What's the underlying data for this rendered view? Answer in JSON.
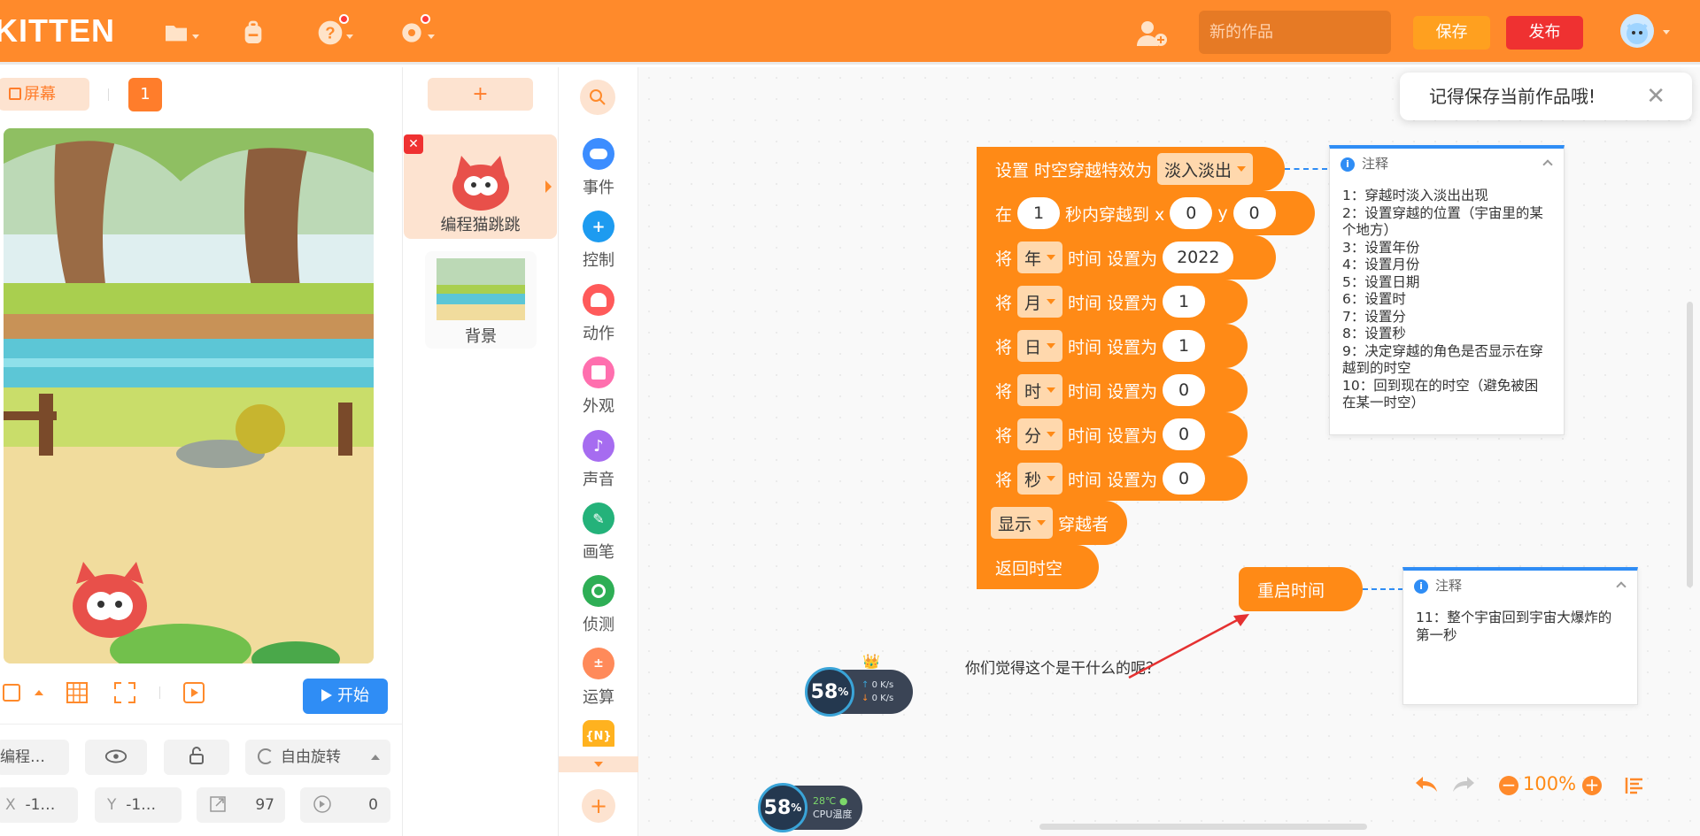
{
  "app": {
    "logo": "KITTEN",
    "project_title_placeholder": "新的作品",
    "save_label": "保存",
    "publish_label": "发布"
  },
  "stage": {
    "screen_button": "屏幕",
    "scene_number": "1",
    "start_label": "开始",
    "sprite_name_field": "编程…",
    "rotate_mode": "自由旋转",
    "x_label": "X",
    "x_value": "-1…",
    "y_label": "Y",
    "y_value": "-1…",
    "size_value": "97",
    "direction_value": "0"
  },
  "sprites": {
    "add_label": "+",
    "items": [
      {
        "name": "编程猫跳跳"
      },
      {
        "name": "背景"
      }
    ]
  },
  "categories": [
    {
      "label": "事件",
      "color": "#3c8dff"
    },
    {
      "label": "控制",
      "color": "#1d9bf0"
    },
    {
      "label": "动作",
      "color": "#ff5a5a"
    },
    {
      "label": "外观",
      "color": "#ff6fae"
    },
    {
      "label": "声音",
      "color": "#a66cf0"
    },
    {
      "label": "画笔",
      "color": "#24b27a"
    },
    {
      "label": "侦测",
      "color": "#2eae55"
    },
    {
      "label": "运算",
      "color": "#ff8a5a"
    },
    {
      "label": "{N}",
      "color": "#ffb21f"
    }
  ],
  "blocks": {
    "set_effect": {
      "text": "设置 时空穿越特效为",
      "option": "淡入淡出"
    },
    "travel": {
      "prefix": "在",
      "secs": "1",
      "mid": "秒内穿越到 x",
      "x": "0",
      "ylabel": "y",
      "y": "0"
    },
    "time_rows": [
      {
        "verb": "将",
        "unit": "年",
        "rest": "时间 设置为",
        "value": "2022"
      },
      {
        "verb": "将",
        "unit": "月",
        "rest": "时间 设置为",
        "value": "1"
      },
      {
        "verb": "将",
        "unit": "日",
        "rest": "时间 设置为",
        "value": "1"
      },
      {
        "verb": "将",
        "unit": "时",
        "rest": "时间 设置为",
        "value": "0"
      },
      {
        "verb": "将",
        "unit": "分",
        "rest": "时间 设置为",
        "value": "0"
      },
      {
        "verb": "将",
        "unit": "秒",
        "rest": "时间 设置为",
        "value": "0"
      }
    ],
    "show": {
      "option": "显示",
      "rest": "穿越者"
    },
    "return": "返回时空",
    "restart": "重启时间"
  },
  "notes": [
    {
      "title": "注释",
      "lines": [
        "1：穿越时淡入淡出出现",
        "2：设置穿越的位置（宇宙里的某个地方）",
        "3：设置年份",
        "4：设置月份",
        "5：设置日期",
        "6：设置时",
        "7：设置分",
        "8：设置秒",
        "9：决定穿越的角色是否显示在穿越到的时空",
        "10：回到现在的时空（避免被困在某一时空）"
      ]
    },
    {
      "title": "注释",
      "lines": [
        "11：整个宇宙回到宇宙大爆炸的第一秒"
      ]
    }
  ],
  "question_text": "你们觉得这个是干什么的呢？",
  "toast": {
    "text": "记得保存当前作品哦!"
  },
  "monitor": {
    "widget1": {
      "percent": "58",
      "unit": "%",
      "up": "0 K/s",
      "down": "0 K/s"
    },
    "widget2": {
      "percent": "58",
      "unit": "%",
      "temp": "28℃",
      "label": "CPU温度"
    }
  },
  "zoom": {
    "value": "100%"
  }
}
